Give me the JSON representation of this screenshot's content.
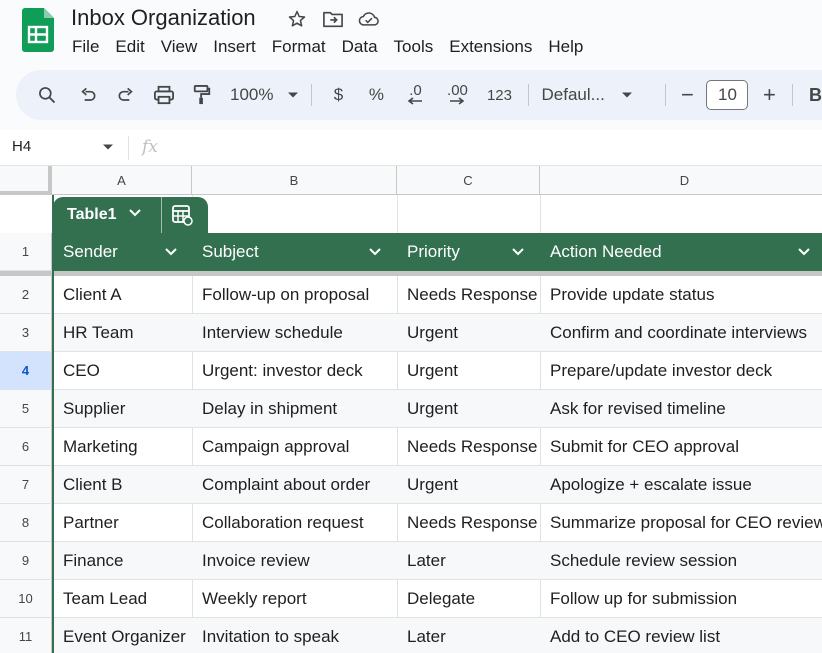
{
  "doc": {
    "title": "Inbox Organization"
  },
  "menu": [
    "File",
    "Edit",
    "View",
    "Insert",
    "Format",
    "Data",
    "Tools",
    "Extensions",
    "Help"
  ],
  "toolbar": {
    "zoom": "100%",
    "currency": "$",
    "percent": "%",
    "dec_decrease": ".0",
    "dec_increase": ".00",
    "number_format": "123",
    "font": "Defaul...",
    "font_size": "10",
    "bold": "B",
    "minus": "−",
    "plus": "+"
  },
  "formula_bar": {
    "cell_ref": "H4",
    "fx": "fx",
    "value": ""
  },
  "grid": {
    "columns": [
      "A",
      "B",
      "C",
      "D"
    ],
    "table_name": "Table1",
    "selected_row": 4,
    "headers": [
      "Sender",
      "Subject",
      "Priority",
      "Action Needed"
    ],
    "rows": [
      {
        "num": "1"
      },
      {
        "num": "2",
        "cells": [
          "Client A",
          "Follow-up on proposal",
          "Needs Response",
          "Provide update status"
        ]
      },
      {
        "num": "3",
        "cells": [
          "HR Team",
          "Interview schedule",
          "Urgent",
          "Confirm and coordinate interviews"
        ]
      },
      {
        "num": "4",
        "cells": [
          "CEO",
          "Urgent: investor deck",
          "Urgent",
          "Prepare/update investor deck"
        ]
      },
      {
        "num": "5",
        "cells": [
          "Supplier",
          "Delay in shipment",
          "Urgent",
          "Ask for revised timeline"
        ]
      },
      {
        "num": "6",
        "cells": [
          "Marketing",
          "Campaign approval",
          "Needs Response",
          "Submit for CEO approval"
        ]
      },
      {
        "num": "7",
        "cells": [
          "Client B",
          "Complaint about order",
          "Urgent",
          "Apologize + escalate issue"
        ]
      },
      {
        "num": "8",
        "cells": [
          "Partner",
          "Collaboration request",
          "Needs Response",
          "Summarize proposal for CEO review"
        ]
      },
      {
        "num": "9",
        "cells": [
          "Finance",
          "Invoice review",
          "Later",
          "Schedule review session"
        ]
      },
      {
        "num": "10",
        "cells": [
          "Team Lead",
          "Weekly report",
          "Delegate",
          "Follow up for submission"
        ]
      },
      {
        "num": "11",
        "cells": [
          "Event Organizer",
          "Invitation to speak",
          "Later",
          "Add to CEO review list"
        ]
      }
    ]
  },
  "colors": {
    "table_header": "#33704f",
    "selected_row_header": "#d3e3fd",
    "toolbar_bg": "#edf2fa"
  }
}
